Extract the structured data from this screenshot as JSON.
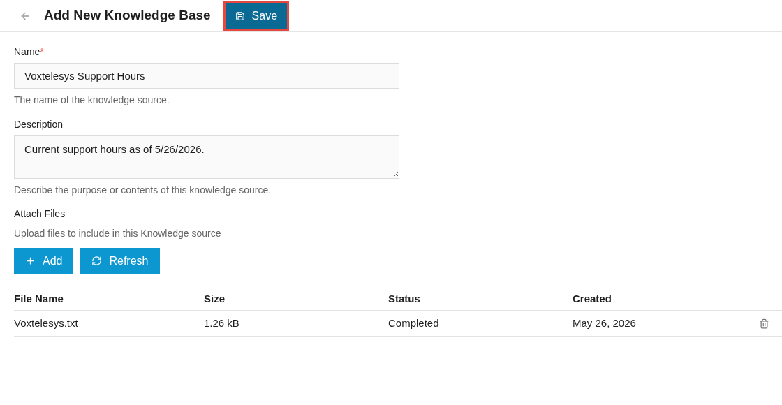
{
  "header": {
    "title": "Add New Knowledge Base",
    "save_button": {
      "label": "Save",
      "highlighted": true
    }
  },
  "fields": [
    {
      "kind": "input",
      "label": "Name",
      "required_mark": "*",
      "value": "Voxtelesys Support Hours",
      "help": "The name of the knowledge source."
    },
    {
      "kind": "textarea",
      "label": "Description",
      "value": "Current support hours as of 5/26/2026.",
      "help": "Describe the purpose or contents of this knowledge source."
    }
  ],
  "attach": {
    "label": "Attach Files",
    "help": "Upload files to include in this Knowledge source",
    "buttons": [
      {
        "kind": "add",
        "label": "Add"
      },
      {
        "kind": "refresh",
        "label": "Refresh"
      }
    ]
  },
  "table": {
    "columns": [
      "File Name",
      "Size",
      "Status",
      "Created"
    ],
    "rows": [
      {
        "cells": [
          "Voxtelesys.txt",
          "1.26 kB",
          "Completed",
          "May 26, 2026"
        ]
      }
    ]
  }
}
